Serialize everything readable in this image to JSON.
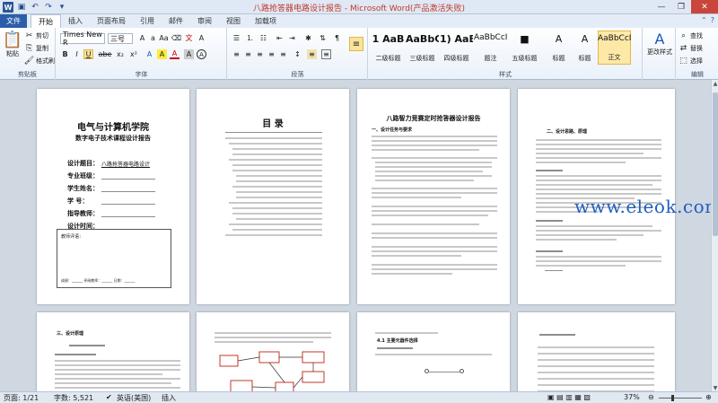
{
  "window": {
    "title": "八路抢答器电路设计报告 - Microsoft Word(产品激活失败)",
    "app_icon": "W"
  },
  "quick_access": [
    "save-icon",
    "undo-icon",
    "redo-icon",
    "customize-icon"
  ],
  "tabs": {
    "file": "文件",
    "items": [
      "开始",
      "插入",
      "页面布局",
      "引用",
      "邮件",
      "审阅",
      "视图",
      "加载项"
    ],
    "active": "开始"
  },
  "ribbon": {
    "clipboard": {
      "label": "剪贴板",
      "paste": "粘贴",
      "cut": "剪切",
      "copy": "复制",
      "format_painter": "格式刷"
    },
    "font": {
      "label": "字体",
      "font_name": "Times New R",
      "font_size": "三号",
      "buttons": [
        "B",
        "I",
        "U",
        "abe",
        "x₂",
        "x²",
        "A",
        "A",
        "A",
        "Aa",
        "A",
        "A"
      ]
    },
    "paragraph": {
      "label": "段落",
      "buttons": [
        "≡",
        "≡",
        "≡",
        "≡",
        "↕",
        "¶",
        "⇤",
        "⇥",
        "≡",
        "≡",
        "≡",
        "≡"
      ]
    },
    "styles": {
      "label": "样式",
      "items": [
        {
          "sample": "1 AaB",
          "name": "二级标题",
          "selected": false
        },
        {
          "sample": "AaBbC",
          "name": "三级标题",
          "selected": false
        },
        {
          "sample": "1) AaB",
          "name": "四级标题",
          "selected": false
        },
        {
          "sample": "AaBbCcI",
          "name": "题注",
          "selected": false
        },
        {
          "sample": "■",
          "name": "五级标题",
          "selected": false
        },
        {
          "sample": "A",
          "name": "标题",
          "selected": false
        },
        {
          "sample": "A",
          "name": "标题",
          "selected": false
        },
        {
          "sample": "AaBbCcI",
          "name": "正文",
          "selected": true
        }
      ],
      "change_styles": "更改样式"
    },
    "editing": {
      "label": "编辑",
      "find": "查找",
      "replace": "替换",
      "select": "选择"
    }
  },
  "pages": {
    "p1": {
      "title": "电气与计算机学院",
      "subtitle": "数字电子技术课程设计报告",
      "fields": [
        "设计题目：",
        "专业班级：",
        "学生姓名：",
        "学    号：",
        "指导教师：",
        "设计时间："
      ],
      "topic": "八路抢答器电路设计",
      "remark_label": "教师评语：",
      "signature": "成绩：______ 评阅教师：______ 日期：______"
    },
    "p2": {
      "title": "目  录"
    },
    "p3": {
      "title": "八路智力竞赛定时抢答器设计报告",
      "section": "一、设计任务与要求"
    },
    "p4": {
      "section": "二、设计思路、原理"
    },
    "p5": {
      "section": "三、设计原理"
    },
    "p7": {
      "section": "4.1  主要元器件选择"
    }
  },
  "status": {
    "page": "页面: 1/21",
    "words": "字数: 5,521",
    "language": "英语(美国)",
    "mode": "插入",
    "zoom": "37%"
  },
  "watermark": "www.eleok.com"
}
